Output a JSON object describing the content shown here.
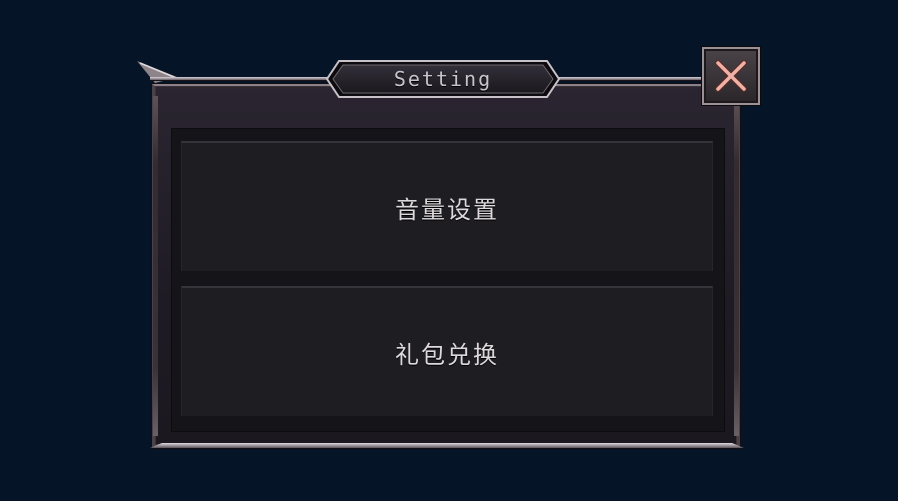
{
  "dialog": {
    "title": "Setting",
    "close_icon": "close-x-icon"
  },
  "menu": {
    "items": [
      {
        "label": "音量设置"
      },
      {
        "label": "礼包兑换"
      }
    ]
  },
  "colors": {
    "background": "#061428",
    "panel": "#1d1d22",
    "frame": "#2a2530",
    "close_x": "#e8a49a"
  }
}
